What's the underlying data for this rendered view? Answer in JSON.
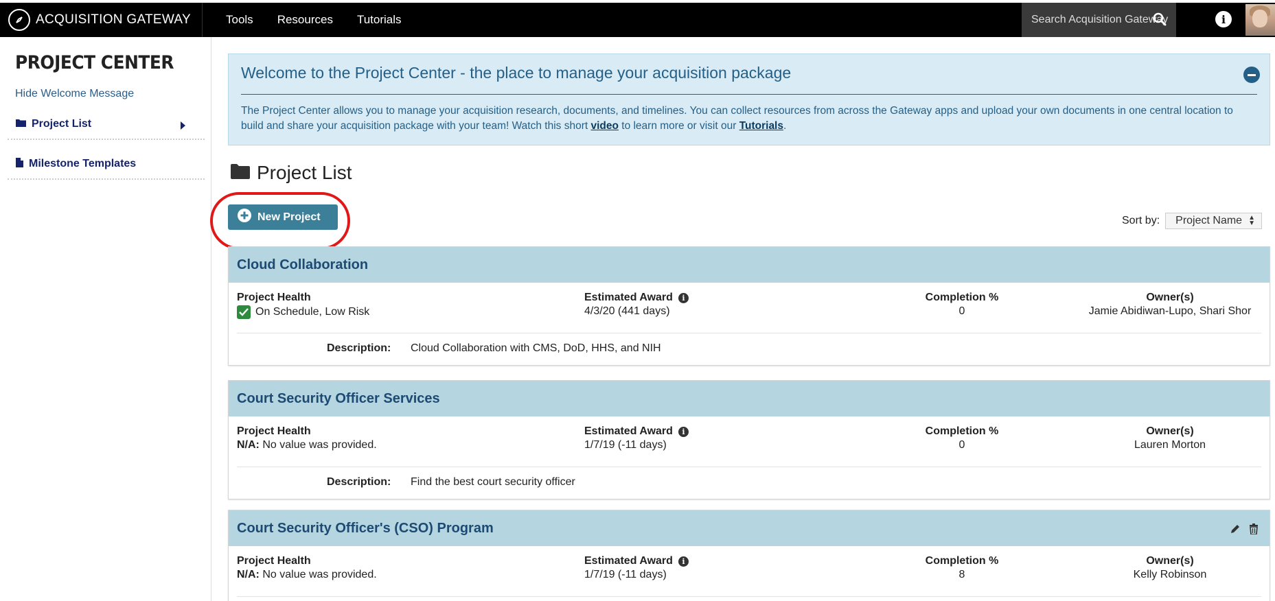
{
  "nav": {
    "brand": "ACQUISITION GATEWAY",
    "links": [
      "Tools",
      "Resources",
      "Tutorials"
    ],
    "search_placeholder": "Search Acquisition Gateway"
  },
  "sidebar": {
    "title": "PROJECT CENTER",
    "hide_welcome": "Hide Welcome Message",
    "items": [
      {
        "label": "Project List",
        "icon": "folder-icon"
      },
      {
        "label": "Milestone Templates",
        "icon": "file-icon"
      }
    ]
  },
  "welcome": {
    "title": "Welcome to the Project Center - the place to manage your acquisition package",
    "body_before_video": "The Project Center allows you to manage your acquisition research, documents, and timelines. You can collect resources from across the Gateway apps and upload your own documents in one central location to build and share your acquisition package with your team! Watch this short ",
    "video_link": "video",
    "body_middle": " to learn more or visit our ",
    "tutorials_link": "Tutorials",
    "body_end": "."
  },
  "project_list": {
    "title": "Project List",
    "new_button": "New Project",
    "sort_label": "Sort by:",
    "sort_value": "Project Name"
  },
  "labels": {
    "health": "Project Health",
    "award": "Estimated Award",
    "completion": "Completion %",
    "owners": "Owner(s)",
    "description": "Description:"
  },
  "projects": [
    {
      "name": "Cloud Collaboration",
      "health_prefix": "",
      "health": "On Schedule, Low Risk",
      "award": "4/3/20 (441 days)",
      "completion": "0",
      "owners": "Jamie Abidiwan-Lupo, Shari Shor",
      "description": "Cloud Collaboration with CMS, DoD, HHS, and NIH"
    },
    {
      "name": "Court Security Officer Services",
      "health_prefix": "N/A:",
      "health": "No value was provided.",
      "award": "1/7/19 (-11 days)",
      "completion": "0",
      "owners": "Lauren Morton",
      "description": "Find the best court security officer"
    },
    {
      "name": "Court Security Officer's (CSO) Program",
      "health_prefix": "N/A:",
      "health": "No value was provided.",
      "award": "1/7/19 (-11 days)",
      "completion": "8",
      "owners": "Kelly Robinson"
    }
  ],
  "colors": {
    "accent": "#3b7f99",
    "card_header": "#b5d6e0",
    "welcome_bg": "#d9ecf5",
    "highlight": "#e01818",
    "on_schedule": "#2e8b3d"
  }
}
